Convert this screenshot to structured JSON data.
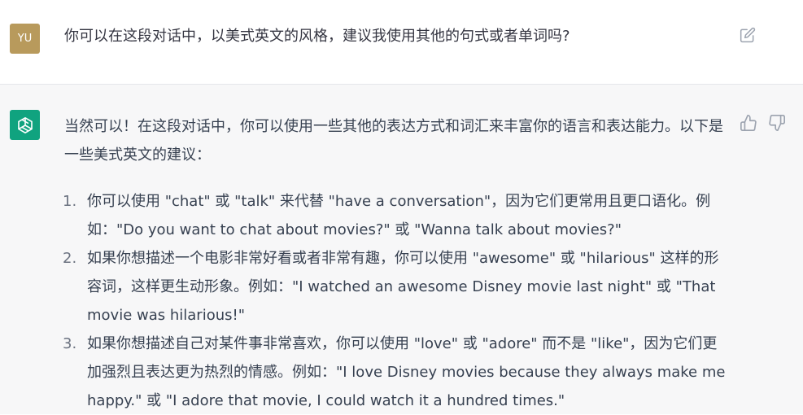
{
  "user_message": {
    "avatar_initials": "YU",
    "text": "你可以在这段对话中，以美式英文的风格，建议我使用其他的句式或者单词吗?"
  },
  "assistant_message": {
    "intro": "当然可以！在这段对话中，你可以使用一些其他的表达方式和词汇来丰富你的语言和表达能力。以下是一些美式英文的建议：",
    "items": [
      {
        "number": "1.",
        "text": "你可以使用 \"chat\" 或 \"talk\" 来代替 \"have a conversation\"，因为它们更常用且更口语化。例如：\"Do you want to chat about movies?\" 或 \"Wanna talk about movies?\""
      },
      {
        "number": "2.",
        "text": "如果你想描述一个电影非常好看或者非常有趣，你可以使用 \"awesome\" 或 \"hilarious\" 这样的形容词，这样更生动形象。例如：\"I watched an awesome Disney movie last night\" 或 \"That movie was hilarious!\""
      },
      {
        "number": "3.",
        "text": "如果你想描述自己对某件事非常喜欢，你可以使用 \"love\" 或 \"adore\" 而不是 \"like\"，因为它们更加强烈且表达更为热烈的情感。例如：\"I love Disney movies because they always make me happy.\" 或 \"I adore that movie, I could watch it a hundred times.\""
      }
    ]
  },
  "icons": {
    "edit": "edit-icon",
    "assistant_logo": "chatgpt-logo-icon",
    "thumbs_up": "thumbs-up-icon",
    "thumbs_down": "thumbs-down-icon"
  },
  "colors": {
    "user_avatar_bg": "#b89a5c",
    "assistant_avatar_bg": "#10a37f",
    "assistant_row_bg": "#f7f7f8",
    "text": "#374151"
  }
}
